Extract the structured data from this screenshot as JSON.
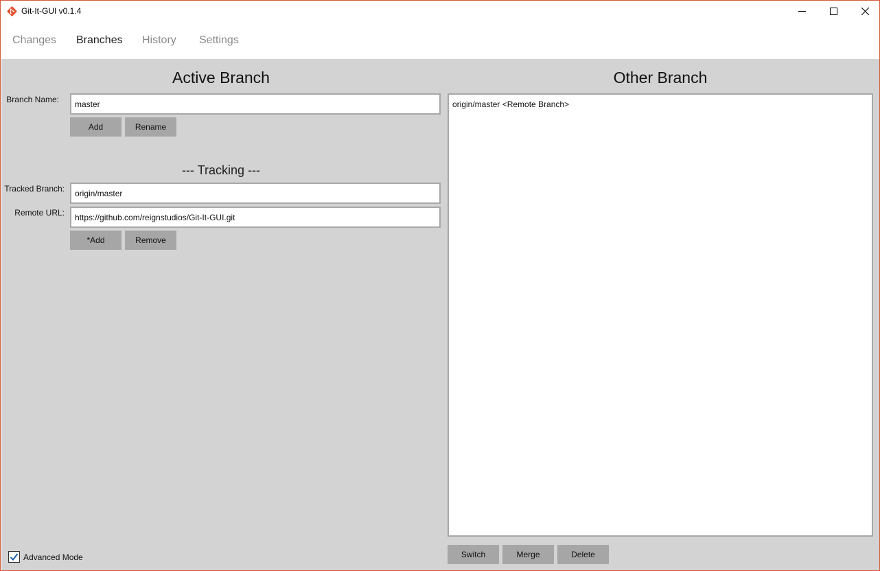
{
  "window": {
    "title": "Git-It-GUI v0.1.4",
    "accent_color": "#d4593b",
    "controls": {
      "minimize": "—",
      "maximize": "☐",
      "close": "✕"
    }
  },
  "tabs": [
    {
      "label": "Changes",
      "active": false
    },
    {
      "label": "Branches",
      "active": true
    },
    {
      "label": "History",
      "active": false
    },
    {
      "label": "Settings",
      "active": false
    }
  ],
  "active_branch": {
    "heading": "Active Branch",
    "branch_name_label": "Branch Name:",
    "branch_name_value": "master",
    "add_label": "Add",
    "rename_label": "Rename",
    "tracking_heading": "--- Tracking ---",
    "tracked_branch_label": "Tracked Branch:",
    "tracked_branch_value": "origin/master",
    "remote_url_label": "Remote URL:",
    "remote_url_value": "https://github.com/reignstudios/Git-It-GUI.git",
    "tracking_add_label": "*Add",
    "remove_label": "Remove"
  },
  "other_branch": {
    "heading": "Other Branch",
    "items": [
      {
        "label": "origin/master <Remote Branch>"
      }
    ],
    "switch_label": "Switch",
    "merge_label": "Merge",
    "delete_label": "Delete"
  },
  "advanced_mode": {
    "label": "Advanced Mode",
    "checked": true
  },
  "colors": {
    "content_bg": "#d3d3d3",
    "button_bg": "#a6a6a6",
    "checkbox_check": "#1e5fa8"
  }
}
